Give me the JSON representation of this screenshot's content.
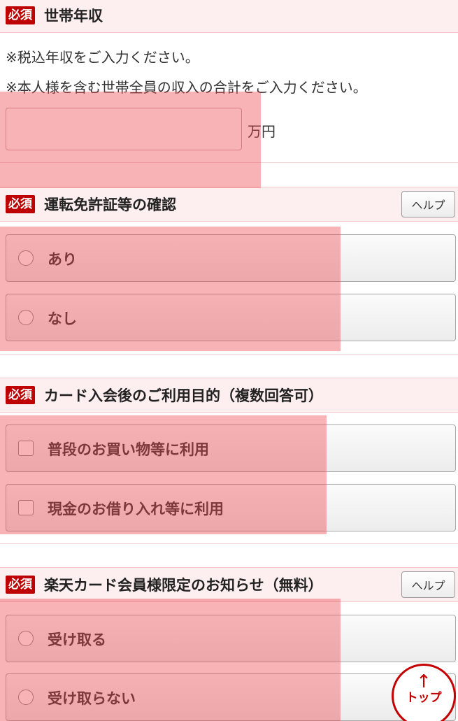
{
  "required_label": "必須",
  "help_label": "ヘルプ",
  "sections": {
    "income": {
      "title": "世帯年収",
      "notes": [
        "※税込年収をご入力ください。",
        "※本人様を含む世帯全員の収入の合計をご入力ください。"
      ],
      "input_value": "",
      "unit": "万円"
    },
    "license": {
      "title": "運転免許証等の確認",
      "options": [
        "あり",
        "なし"
      ]
    },
    "purpose": {
      "title": "カード入会後のご利用目的（複数回答可）",
      "options": [
        "普段のお買い物等に利用",
        "現金のお借り入れ等に利用"
      ]
    },
    "newsletter": {
      "title": "楽天カード会員様限定のお知らせ（無料）",
      "options": [
        "受け取る",
        "受け取らない"
      ]
    }
  },
  "top_button": {
    "arrow": "↑",
    "label": "トップ"
  },
  "colors": {
    "required_badge": "#bf0000",
    "header_bg": "#fdeeef",
    "overlay": "#ec4048",
    "top_button": "#c40000"
  }
}
